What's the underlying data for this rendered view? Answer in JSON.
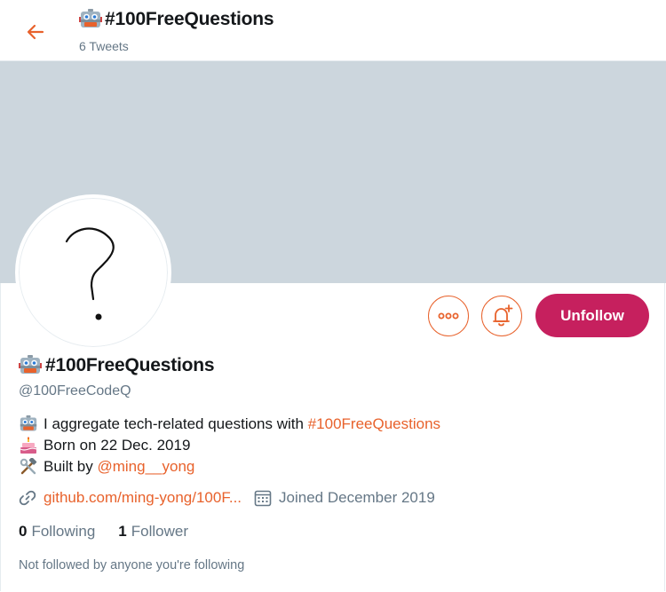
{
  "header": {
    "title": "#100FreeQuestions",
    "tweet_count": "6 Tweets",
    "back_icon": "arrow-left-icon"
  },
  "colors": {
    "accent": "#e8622c",
    "unfollow_bg": "#c6205e",
    "banner": "#ccd6dd",
    "muted": "#657786"
  },
  "actions": {
    "more_icon": "more-dots-icon",
    "notify_icon": "bell-plus-icon",
    "unfollow_label": "Unfollow"
  },
  "profile": {
    "name": "#100FreeQuestions",
    "handle": "@100FreeCodeQ",
    "avatar_icon": "question-mark-sketch"
  },
  "bio": {
    "line1_text": "I aggregate tech-related questions with ",
    "line1_link": "#100FreeQuestions",
    "line2_text": "Born on 22 Dec. 2019",
    "line3_text": "Built by ",
    "line3_link": "@ming__yong"
  },
  "meta": {
    "website": "github.com/ming-yong/100F...",
    "joined": "Joined December 2019"
  },
  "follow": {
    "following_count": "0",
    "following_label": "Following",
    "followers_count": "1",
    "followers_label": "Follower"
  },
  "footer": {
    "not_followed": "Not followed by anyone you're following"
  }
}
